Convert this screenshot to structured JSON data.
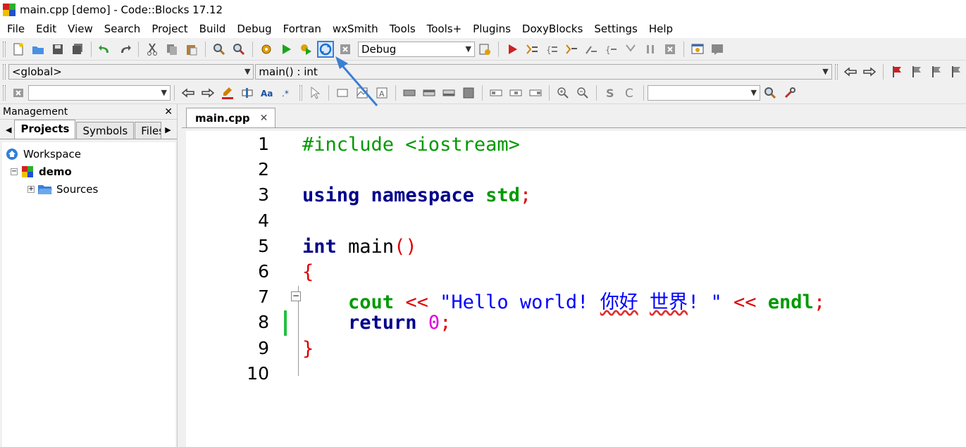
{
  "window": {
    "title": "main.cpp [demo] - Code::Blocks 17.12"
  },
  "menu": [
    "File",
    "Edit",
    "View",
    "Search",
    "Project",
    "Build",
    "Debug",
    "Fortran",
    "wxSmith",
    "Tools",
    "Tools+",
    "Plugins",
    "DoxyBlocks",
    "Settings",
    "Help"
  ],
  "toolbar": {
    "build_target": "Debug",
    "scope": "<global>",
    "symbol": "main() : int",
    "search_value": "",
    "find_value": ""
  },
  "management": {
    "title": "Management",
    "close": "✕",
    "tabs": [
      "Projects",
      "Symbols",
      "Files"
    ],
    "tree": {
      "workspace": "Workspace",
      "project": "demo",
      "folder": "Sources"
    }
  },
  "editor": {
    "tab_label": "main.cpp",
    "tab_close": "✕",
    "lines": [
      {
        "n": "1",
        "tokens": [
          {
            "t": "#include <iostream>",
            "c": "pp"
          }
        ]
      },
      {
        "n": "2",
        "tokens": []
      },
      {
        "n": "3",
        "tokens": [
          {
            "t": "using",
            "c": "kw"
          },
          {
            "t": " ",
            "c": ""
          },
          {
            "t": "namespace",
            "c": "kw"
          },
          {
            "t": " ",
            "c": ""
          },
          {
            "t": "std",
            "c": "grn"
          },
          {
            "t": ";",
            "c": "op"
          }
        ]
      },
      {
        "n": "4",
        "tokens": []
      },
      {
        "n": "5",
        "tokens": [
          {
            "t": "int",
            "c": "kw"
          },
          {
            "t": " main",
            "c": ""
          },
          {
            "t": "()",
            "c": "op"
          }
        ]
      },
      {
        "n": "6",
        "tokens": [
          {
            "t": "{",
            "c": "op"
          }
        ]
      },
      {
        "n": "7",
        "tokens": [
          {
            "t": "    ",
            "c": ""
          },
          {
            "t": "cout",
            "c": "grn"
          },
          {
            "t": " ",
            "c": ""
          },
          {
            "t": "<<",
            "c": "op"
          },
          {
            "t": " \"Hello world! ",
            "c": "str"
          },
          {
            "t": "你好",
            "c": "str sq"
          },
          {
            "t": " ",
            "c": "str"
          },
          {
            "t": "世界",
            "c": "str sq"
          },
          {
            "t": "! \"",
            "c": "str"
          },
          {
            "t": " ",
            "c": ""
          },
          {
            "t": "<<",
            "c": "op"
          },
          {
            "t": " ",
            "c": ""
          },
          {
            "t": "endl",
            "c": "grn"
          },
          {
            "t": ";",
            "c": "op"
          }
        ]
      },
      {
        "n": "8",
        "tokens": [
          {
            "t": "    ",
            "c": ""
          },
          {
            "t": "return",
            "c": "kw"
          },
          {
            "t": " ",
            "c": ""
          },
          {
            "t": "0",
            "c": "num"
          },
          {
            "t": ";",
            "c": "op"
          }
        ]
      },
      {
        "n": "9",
        "tokens": [
          {
            "t": "}",
            "c": "op"
          }
        ]
      },
      {
        "n": "10",
        "tokens": []
      }
    ]
  },
  "colors": {
    "highlight_border": "#3a7fd5",
    "arrow": "#3a7fd5"
  }
}
